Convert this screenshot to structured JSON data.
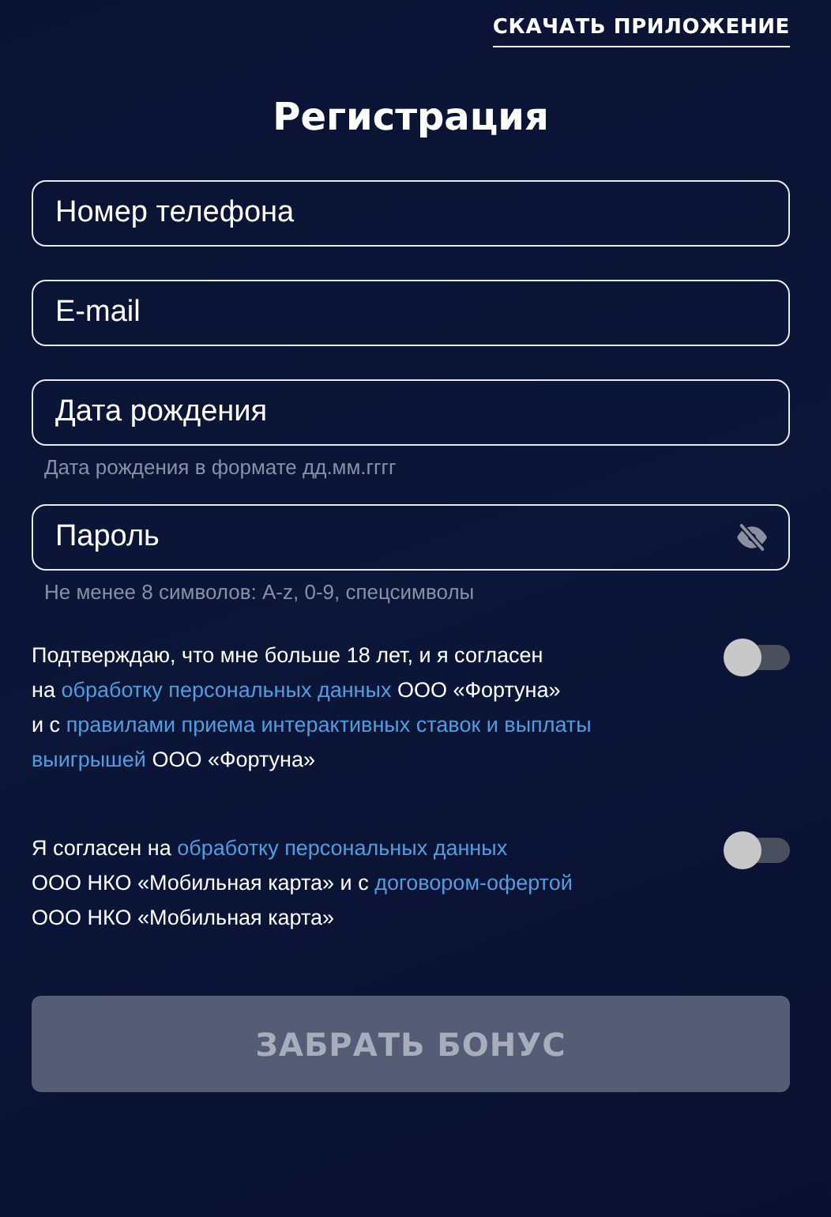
{
  "header": {
    "download_link": "СКАЧАТЬ ПРИЛОЖЕНИЕ"
  },
  "title": "Регистрация",
  "fields": [
    {
      "placeholder": "Номер телефона",
      "kind": "text"
    },
    {
      "placeholder": "E-mail",
      "kind": "text"
    },
    {
      "placeholder": "Дата рождения",
      "kind": "text",
      "hint": "Дата рождения в формате дд.мм.гггг"
    },
    {
      "placeholder": "Пароль",
      "kind": "password",
      "hint": "Не менее 8 символов: A-z, 0-9, спецсимволы"
    }
  ],
  "consents": [
    {
      "on": false,
      "lines": [
        [
          {
            "kind": "text",
            "text": "Подтверждаю, что мне больше 18 лет, и я согласен"
          }
        ],
        [
          {
            "kind": "text",
            "text": "на"
          },
          {
            "kind": "link",
            "text": "обработку персональных данных"
          },
          {
            "kind": "text",
            "text": "ООО «Фортуна»"
          }
        ],
        [
          {
            "kind": "text",
            "text": "и с"
          },
          {
            "kind": "link",
            "text": "правилами приема интерактивных ставок и выплаты"
          }
        ],
        [
          {
            "kind": "link",
            "text": "выигрышей"
          },
          {
            "kind": "text",
            "text": "ООО «Фортуна»"
          }
        ]
      ]
    },
    {
      "on": false,
      "lines": [
        [
          {
            "kind": "text",
            "text": "Я согласен на"
          },
          {
            "kind": "link",
            "text": "обработку персональных данных"
          }
        ],
        [
          {
            "kind": "text",
            "text": "ООО НКО «Мобильная карта» и с"
          },
          {
            "kind": "link",
            "text": "договором-офертой"
          }
        ],
        [
          {
            "kind": "text",
            "text": "ООО НКО «Мобильная карта»"
          }
        ]
      ]
    }
  ],
  "submit": {
    "label": "ЗАБРАТЬ БОНУС",
    "disabled": true
  }
}
